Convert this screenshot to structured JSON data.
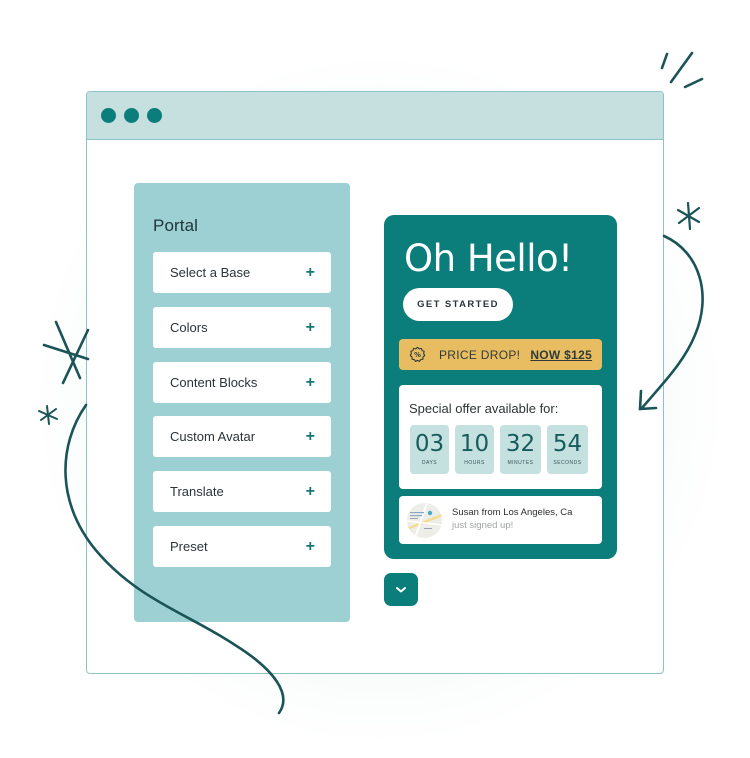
{
  "window": {
    "controls": [
      "close",
      "minimize",
      "maximize"
    ]
  },
  "sidebar": {
    "title": "Portal",
    "items": [
      {
        "label": "Select a Base",
        "icon": "+"
      },
      {
        "label": "Colors",
        "icon": "+"
      },
      {
        "label": "Content Blocks",
        "icon": "+"
      },
      {
        "label": "Custom Avatar",
        "icon": "+"
      },
      {
        "label": "Translate",
        "icon": "+"
      },
      {
        "label": "Preset",
        "icon": "+"
      }
    ]
  },
  "card": {
    "headline": "Oh Hello!",
    "cta_label": "GET STARTED",
    "price_banner": {
      "icon": "percent-badge-icon",
      "text": "PRICE DROP!",
      "link": "NOW $125"
    },
    "offer": {
      "title": "Special offer available for:",
      "timer": [
        {
          "value": "03",
          "unit": "DAYS"
        },
        {
          "value": "10",
          "unit": "HOURS"
        },
        {
          "value": "32",
          "unit": "MINUTES"
        },
        {
          "value": "54",
          "unit": "SECONDS"
        }
      ]
    },
    "notification": {
      "name": "Susan from Los Angeles, Ca",
      "message": "just signed up!"
    }
  },
  "colors": {
    "brand": "#0b7e7b",
    "sidebar_bg": "#9dd0d2",
    "titlebar_bg": "#c6e0df",
    "price_banner": "#e8bd62",
    "timer_box": "#c4e0df",
    "decoration": "#1a5458"
  }
}
